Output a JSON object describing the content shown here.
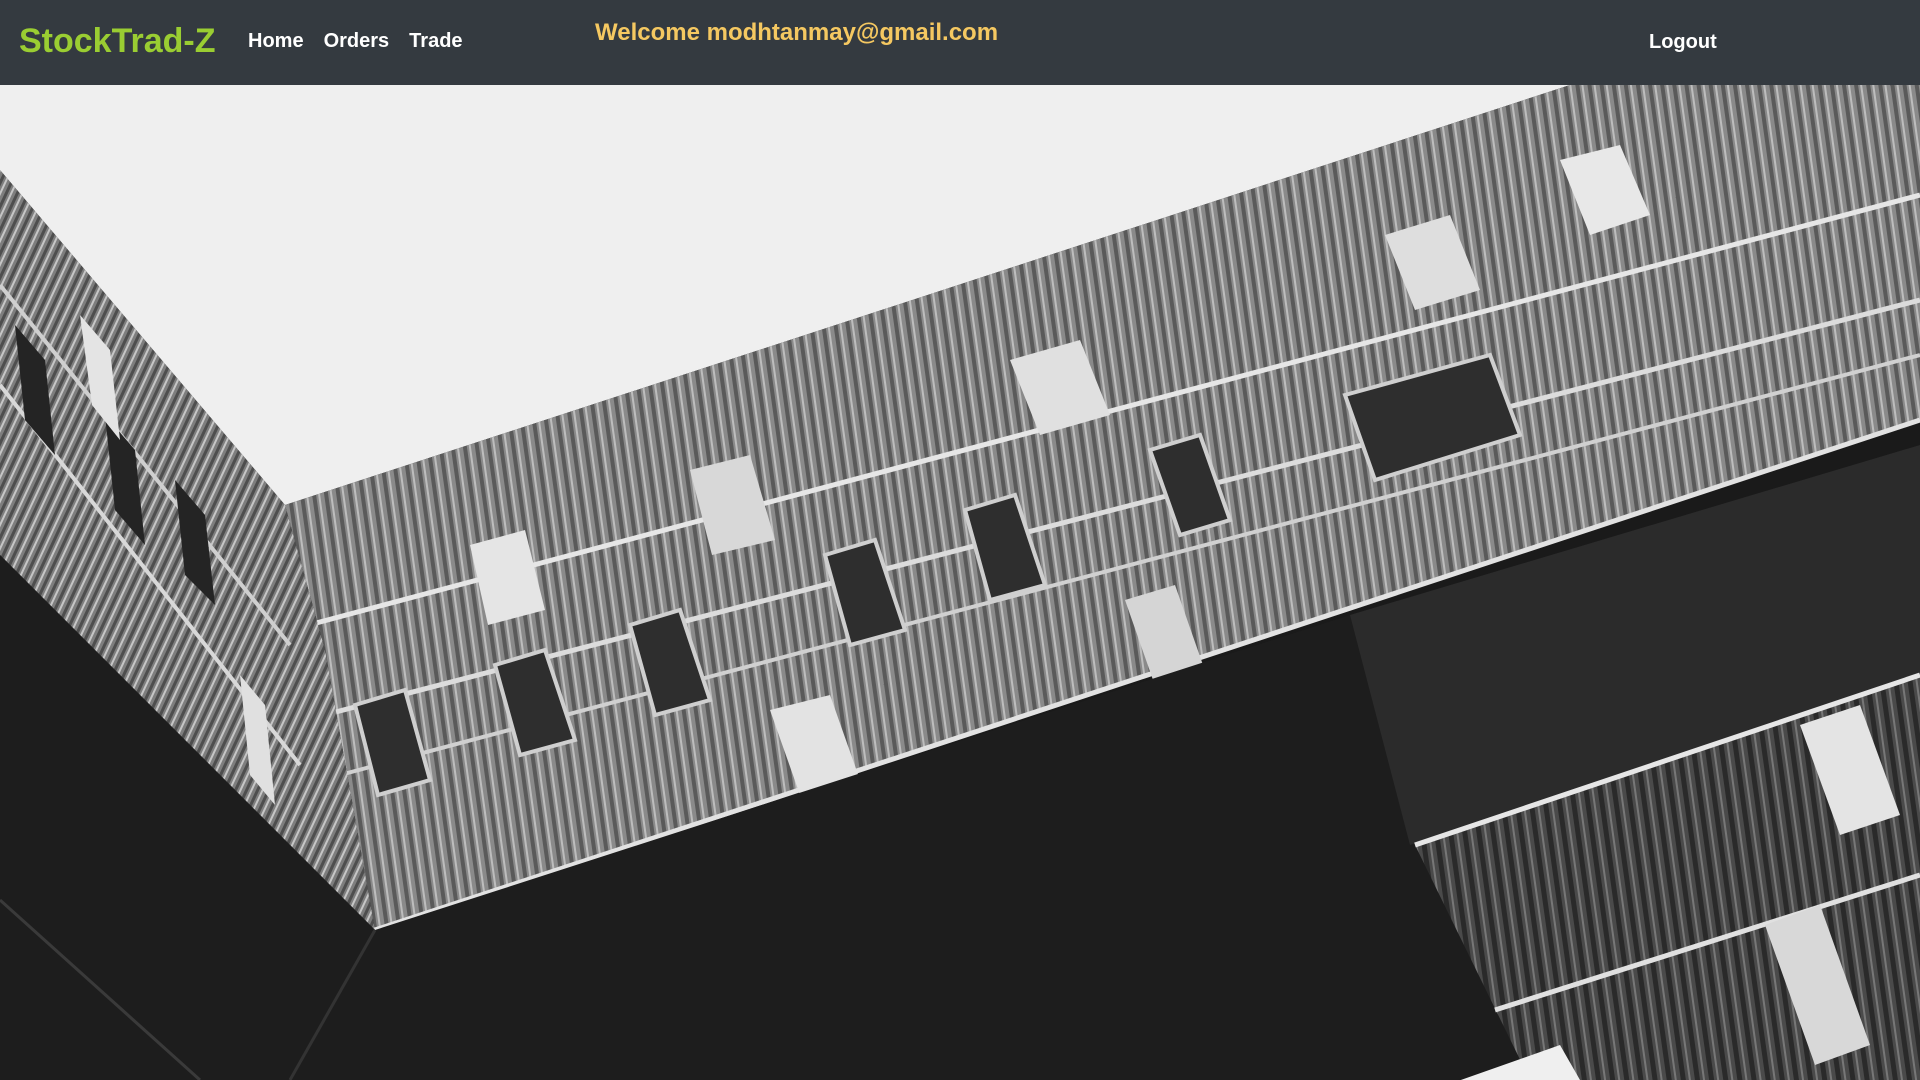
{
  "navbar": {
    "brand": "StockTrad-Z",
    "links": [
      {
        "label": "Home"
      },
      {
        "label": "Orders"
      },
      {
        "label": "Trade"
      }
    ],
    "welcome": "Welcome modhtanmay@gmail.com",
    "logout": "Logout"
  },
  "colors": {
    "navbar_bg": "#343a40",
    "brand": "#9acd32",
    "welcome": "#f5c861",
    "link": "#ffffff"
  },
  "hero": {
    "image_description_icon": "building-photo"
  }
}
